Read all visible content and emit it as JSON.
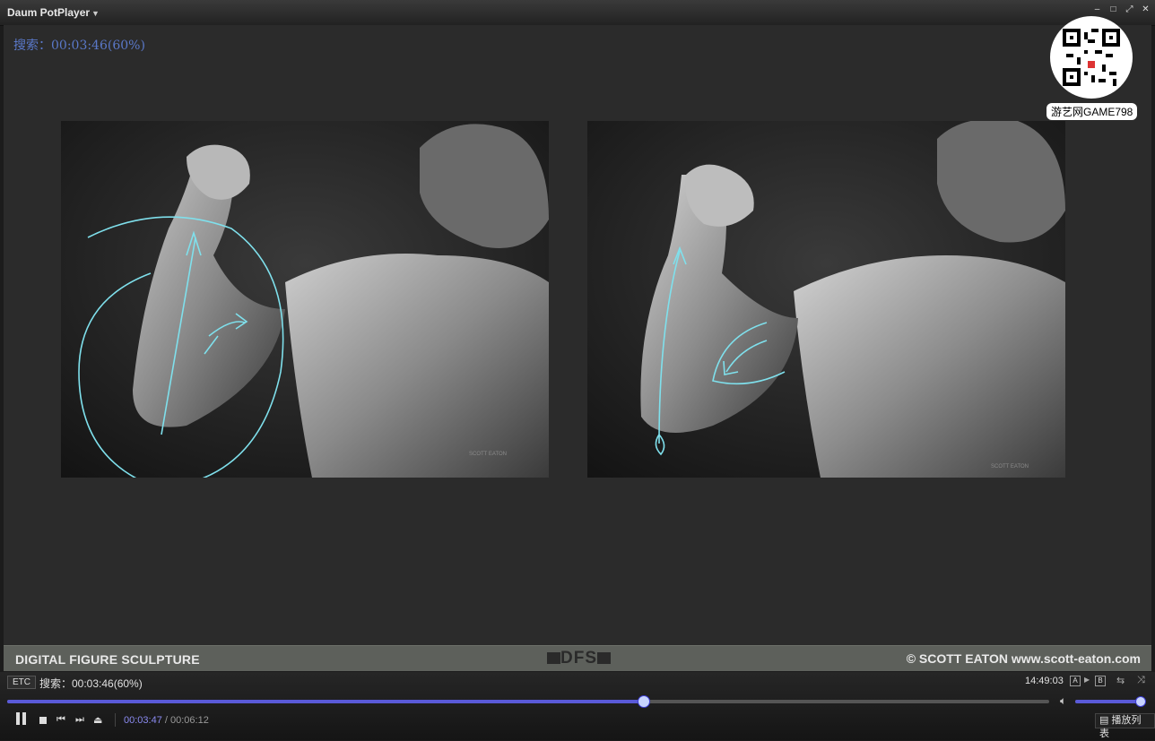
{
  "window": {
    "title": "Daum PotPlayer"
  },
  "osd": {
    "text": "搜索：00:03:46(60%)"
  },
  "watermark": {
    "label": "游艺网GAME798"
  },
  "banner": {
    "left": "DIGITAL FIGURE SCULPTURE",
    "center": "DFS",
    "right": "© SCOTT EATON  www.scott-eaton.com"
  },
  "statusbar": {
    "etc_label": "ETC",
    "status": "搜索：00:03:46(60%)",
    "clock": "14:49:03",
    "a_label": "A",
    "b_label": "B"
  },
  "playback": {
    "current": "00:03:47",
    "separator": " / ",
    "duration": "00:06:12",
    "progress_fraction": 0.61,
    "volume_fraction": 1.0,
    "state": "playing"
  },
  "buttons": {
    "playlist": "播放列表"
  },
  "icons": {
    "pause": "pause-icon",
    "stop": "stop-icon",
    "prev": "previous-icon",
    "next": "next-icon",
    "eject": "eject-icon",
    "volume": "speaker-icon"
  },
  "colors": {
    "accent": "#5a5ad8",
    "annotation": "#7fe0ec",
    "osd": "#5a78c8"
  }
}
